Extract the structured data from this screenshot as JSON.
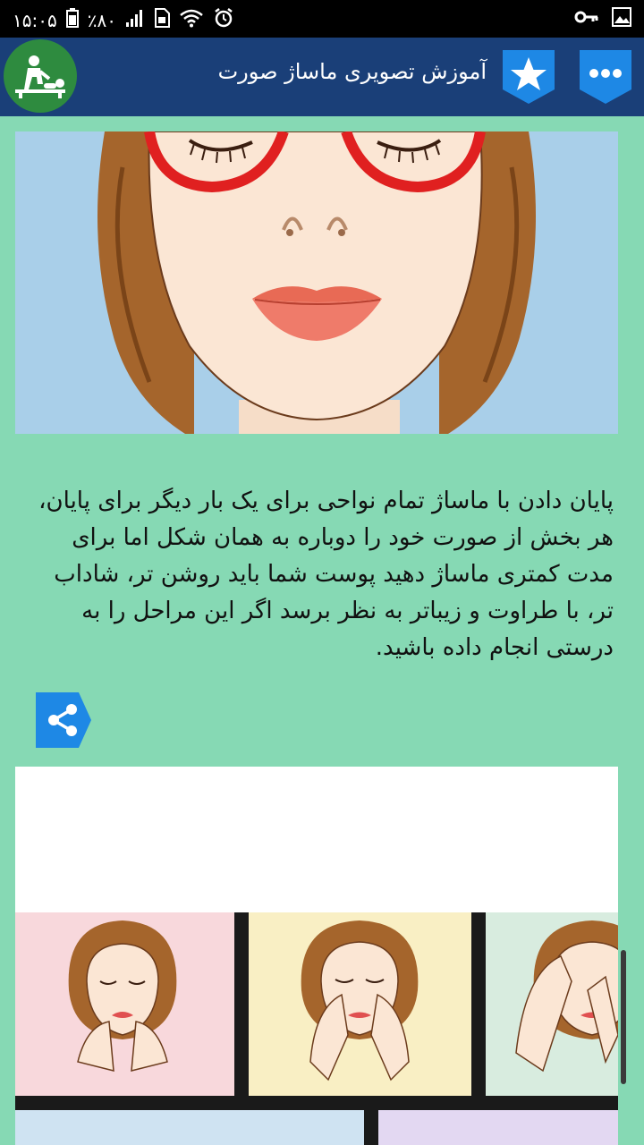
{
  "status_bar": {
    "time": "۱۵:۰۵",
    "battery": "٪۸۰",
    "icons": [
      "signal-icon",
      "wifi-icon",
      "alarm-icon",
      "key-icon",
      "image-icon",
      "sim-icon",
      "battery-icon"
    ]
  },
  "app_bar": {
    "title": "آموزش تصویری ماساژ صورت",
    "colors": {
      "bar": "#1a3f78",
      "logo": "#2e8b3f",
      "button": "#1e88e5"
    }
  },
  "article": {
    "paragraph": "پایان دادن با ماساژ تمام نواحی برای یک بار دیگر برای پایان، هر بخش از صورت خود را دوباره به همان شکل اما برای مدت کمتری ماساژ دهید پوست شما باید روشن تر، شاداب تر، با طراوت و زیباتر به نظر برسد اگر این مراحل را به درستی انجام داده باشید."
  },
  "colors": {
    "background": "#86d9b4",
    "share": "#1e88e5"
  }
}
